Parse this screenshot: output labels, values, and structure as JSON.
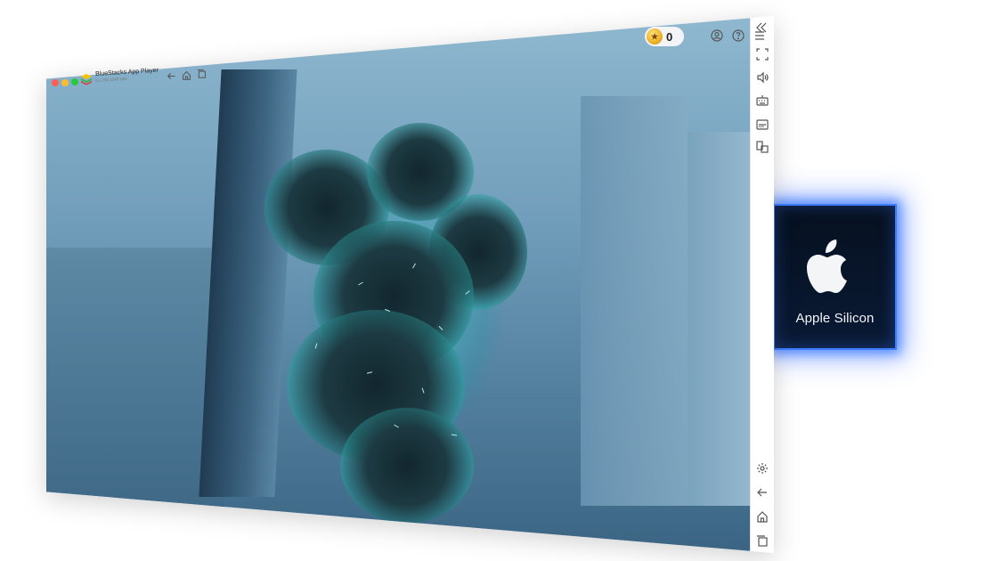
{
  "window": {
    "app_title": "BlueStacks App Player",
    "version": "5.x.100.1048 N64",
    "coin_count": "0"
  },
  "traffic_lights": [
    "#ff5f57",
    "#febc2e",
    "#28c840"
  ],
  "toolbar_left": [
    {
      "name": "back-icon"
    },
    {
      "name": "home-icon"
    },
    {
      "name": "recent-apps-icon"
    }
  ],
  "toolbar_right": [
    {
      "name": "coin-icon"
    },
    {
      "name": "account-icon"
    },
    {
      "name": "help-icon"
    },
    {
      "name": "menu-icon"
    },
    {
      "name": "collapse-sidebar-icon"
    }
  ],
  "sidebar_top": [
    {
      "name": "fullscreen-icon"
    },
    {
      "name": "volume-icon"
    },
    {
      "name": "keyboard-controls-icon"
    },
    {
      "name": "install-apk-icon"
    },
    {
      "name": "multi-instance-icon"
    }
  ],
  "sidebar_bottom": [
    {
      "name": "settings-icon"
    },
    {
      "name": "back-icon"
    },
    {
      "name": "home-icon"
    },
    {
      "name": "recent-apps-icon"
    }
  ],
  "chip_card": {
    "label": "Apple Silicon",
    "glow_color": "#3f7dff"
  }
}
